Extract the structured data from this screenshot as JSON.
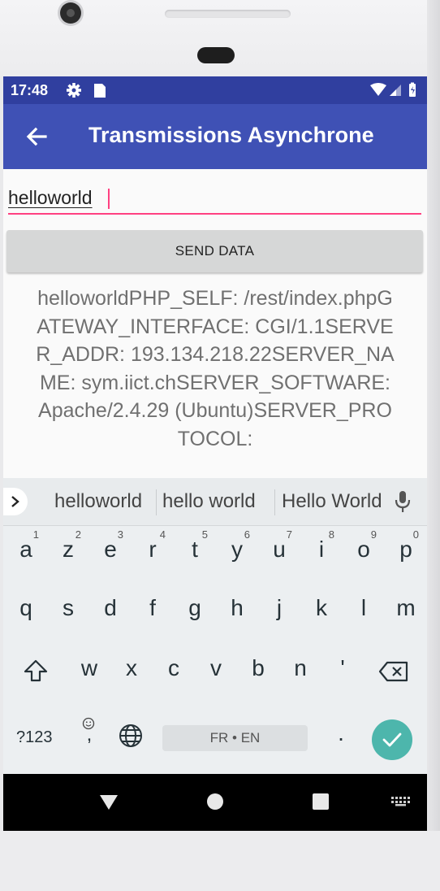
{
  "status_bar": {
    "time": "17:48"
  },
  "app_bar": {
    "title": "Transmissions Asynchrone"
  },
  "input": {
    "value": "helloworld"
  },
  "send_button": {
    "label": "SEND DATA"
  },
  "response": {
    "text": "helloworldPHP_SELF: /rest/index.phpGATEWAY_INTERFACE: CGI/1.1SERVER_ADDR: 193.134.218.22SERVER_NAME: sym.iict.chSERVER_SOFTWARE: Apache/2.4.29 (Ubuntu)SERVER_PROTOCOL:"
  },
  "keyboard": {
    "suggestions": [
      "helloworld",
      "hello world",
      "Hello World"
    ],
    "row1": [
      {
        "key": "a",
        "sup": "1"
      },
      {
        "key": "z",
        "sup": "2"
      },
      {
        "key": "e",
        "sup": "3"
      },
      {
        "key": "r",
        "sup": "4"
      },
      {
        "key": "t",
        "sup": "5"
      },
      {
        "key": "y",
        "sup": "6"
      },
      {
        "key": "u",
        "sup": "7"
      },
      {
        "key": "i",
        "sup": "8"
      },
      {
        "key": "o",
        "sup": "9"
      },
      {
        "key": "p",
        "sup": "0"
      }
    ],
    "row2": [
      "q",
      "s",
      "d",
      "f",
      "g",
      "h",
      "j",
      "k",
      "l",
      "m"
    ],
    "row3": [
      "w",
      "x",
      "c",
      "v",
      "b",
      "n",
      "'"
    ],
    "symbols_key": "?123",
    "comma_key": ",",
    "space_label": "FR • EN",
    "period_key": ".",
    "colors": {
      "enter": "#4db6ac",
      "accent": "#ff4081",
      "app_bar": "#3f51b5",
      "status_bar": "#303f9f"
    }
  }
}
